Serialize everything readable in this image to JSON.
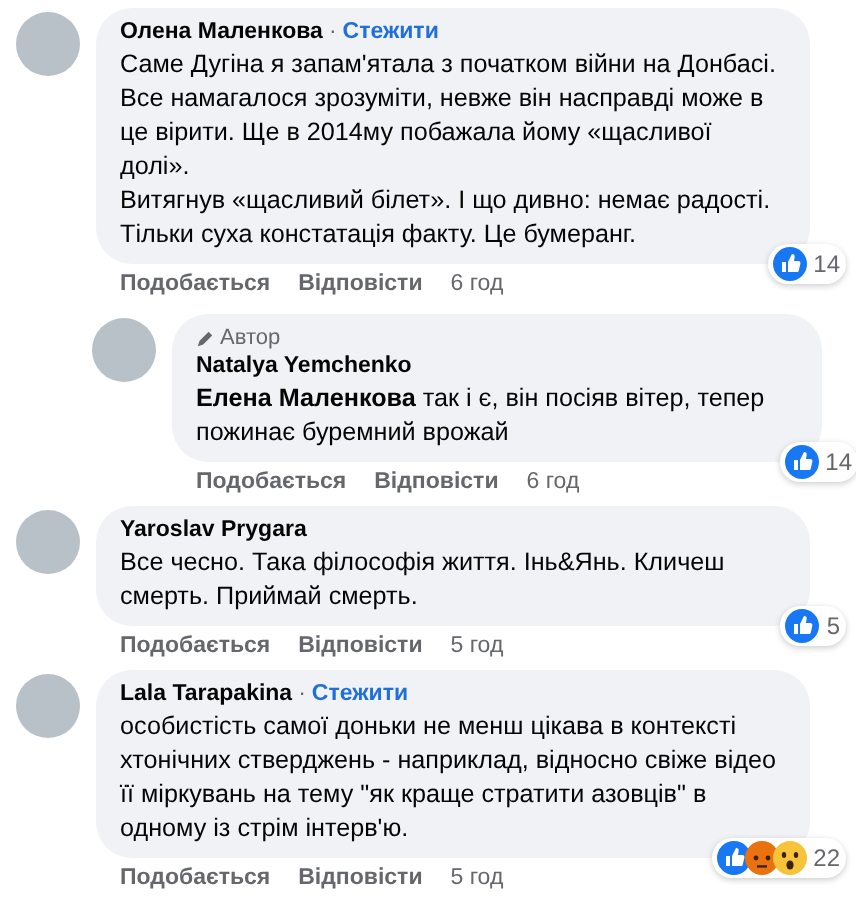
{
  "comments": [
    {
      "author": "Олена Маленкова",
      "separator": "·",
      "follow": "Стежити",
      "text": "Саме Дугіна я запам'ятала з початком війни на Донбасі. Все намагалося зрозуміти, невже він насправді може в це вірити. Ще в 2014му побажала йому «щасливої долі».\nВитягнув «щасливий білет». І що дивно: немає радості. Тільки суха констатація факту. Це бумеранг.",
      "reactions": {
        "icons": [
          {
            "kind": "like"
          }
        ],
        "count": "14"
      },
      "actions": {
        "like": "Подобається",
        "reply": "Відповісти",
        "time": "6 год"
      },
      "children": [
        {
          "author": "Natalya Yemchenko",
          "badge": "Автор",
          "text": "**Елена Маленкова** так і є, він посіяв вітер, тепер пожинає буремний врожай",
          "reactions": {
            "icons": [
              {
                "kind": "like"
              }
            ],
            "count": "14"
          },
          "actions": {
            "like": "Подобається",
            "reply": "Відповісти",
            "time": "6 год"
          }
        }
      ]
    },
    {
      "author": "Yaroslav Prygara",
      "text": "Все чесно. Така філософія життя. Інь&Янь. Кличеш смерть. Приймай смерть.",
      "reactions": {
        "icons": [
          {
            "kind": "like"
          }
        ],
        "count": "5"
      },
      "actions": {
        "like": "Подобається",
        "reply": "Відповісти",
        "time": "5 год"
      }
    },
    {
      "author": "Lala Tarapakina",
      "separator": "·",
      "follow": "Стежити",
      "text": "особистість самої доньки не менш цікава в контексті хтонічних стверджень - наприклад, відносно свіже відео її міркувань на тему \"як краще стратити азовців\" в одному із стрім інтерв'ю.",
      "reactions": {
        "icons": [
          {
            "kind": "like"
          },
          {
            "kind": "angry"
          },
          {
            "kind": "wow"
          }
        ],
        "count": "22"
      },
      "actions": {
        "like": "Подобається",
        "reply": "Відповісти",
        "time": "5 год"
      }
    }
  ]
}
